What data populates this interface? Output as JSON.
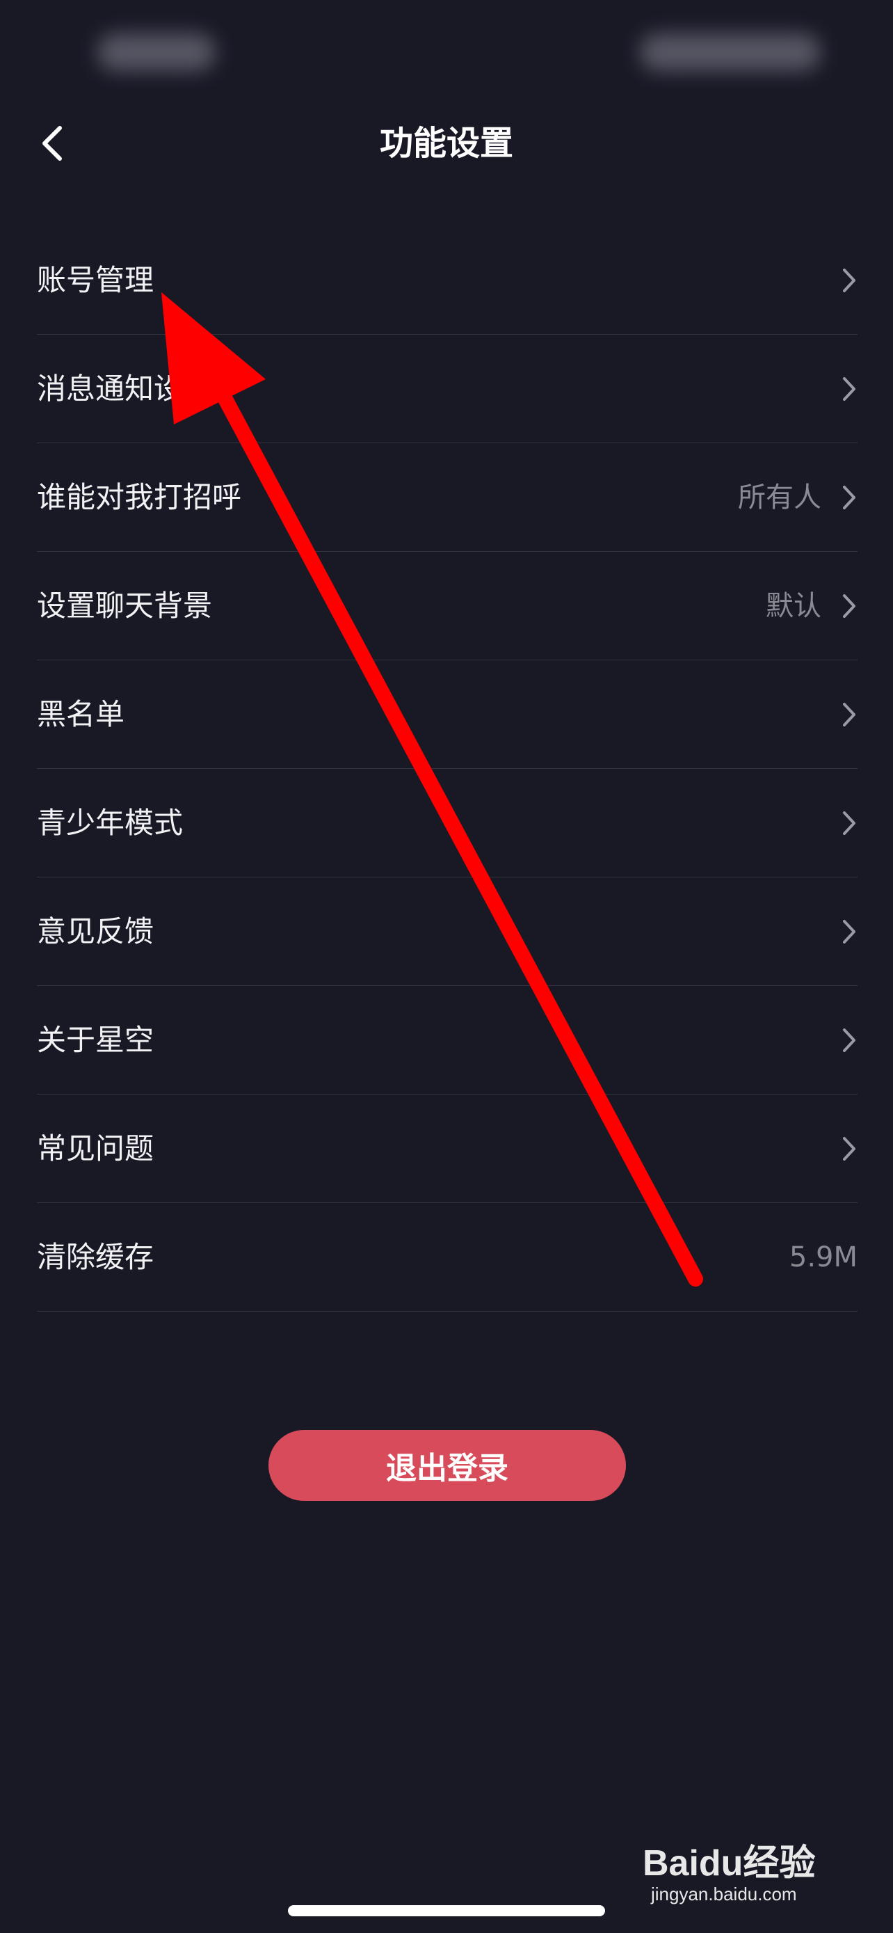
{
  "nav": {
    "title": "功能设置"
  },
  "settings": [
    {
      "label": "账号管理",
      "value": "",
      "chevron": true
    },
    {
      "label": "消息通知设置",
      "value": "",
      "chevron": true
    },
    {
      "label": "谁能对我打招呼",
      "value": "所有人",
      "chevron": true
    },
    {
      "label": "设置聊天背景",
      "value": "默认",
      "chevron": true
    },
    {
      "label": "黑名单",
      "value": "",
      "chevron": true
    },
    {
      "label": "青少年模式",
      "value": "",
      "chevron": true
    },
    {
      "label": "意见反馈",
      "value": "",
      "chevron": true
    },
    {
      "label": "关于星空",
      "value": "",
      "chevron": true
    },
    {
      "label": "常见问题",
      "value": "",
      "chevron": true
    },
    {
      "label": "清除缓存",
      "value": "5.9M",
      "chevron": false
    }
  ],
  "logout_label": "退出登录",
  "watermark": {
    "logo": "Baidu经验",
    "url": "jingyan.baidu.com"
  },
  "colors": {
    "background": "#191926",
    "logout": "#d74b5b",
    "annotation_arrow": "#ff0000"
  }
}
